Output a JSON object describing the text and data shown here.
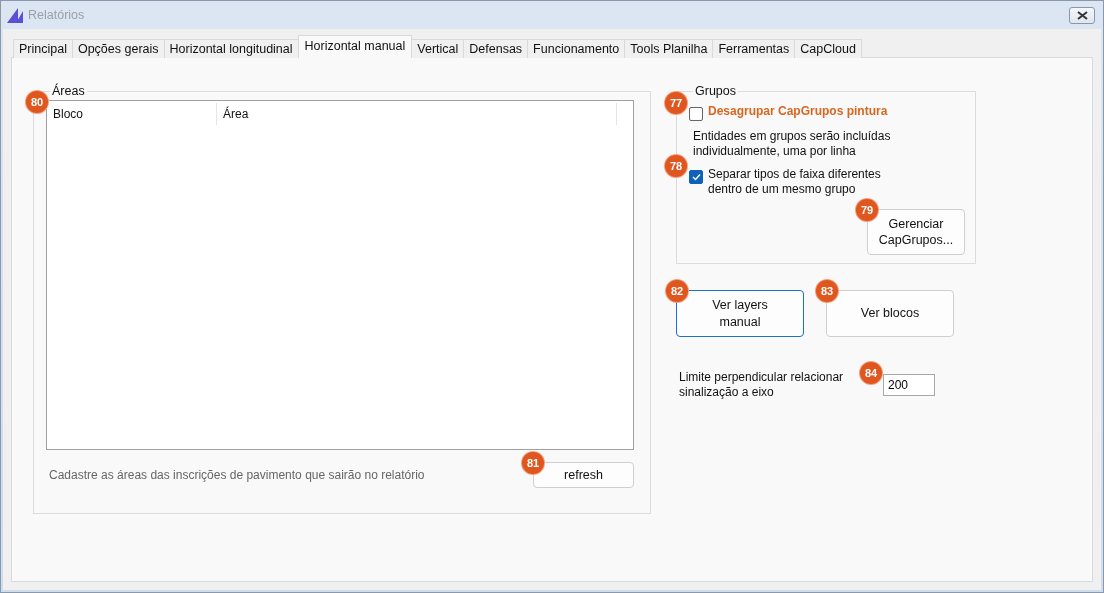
{
  "window": {
    "title": "Relatórios"
  },
  "tabs": [
    {
      "label": "Principal",
      "selected": false
    },
    {
      "label": "Opções gerais",
      "selected": false
    },
    {
      "label": "Horizontal longitudinal",
      "selected": false
    },
    {
      "label": "Horizontal manual",
      "selected": true
    },
    {
      "label": "Vertical",
      "selected": false
    },
    {
      "label": "Defensas",
      "selected": false
    },
    {
      "label": "Funcionamento",
      "selected": false
    },
    {
      "label": "Tools Planilha",
      "selected": false
    },
    {
      "label": "Ferramentas",
      "selected": false
    },
    {
      "label": "CapCloud",
      "selected": false
    }
  ],
  "areas": {
    "title": "Áreas",
    "badge": "80",
    "columns": [
      "Bloco",
      "Área"
    ],
    "hint": "Cadastre as áreas das inscrições de pavimento que sairão no relatório",
    "refresh_button": {
      "label": "refresh",
      "badge": "81"
    }
  },
  "grupos": {
    "title": "Grupos",
    "options": [
      {
        "label": "Desagrupar CapGrupos pintura",
        "checked": false,
        "highlighted": true,
        "badge": "77"
      },
      {
        "kind": "note",
        "label": "Entidades em grupos serão incluídas individualmente, uma por linha"
      },
      {
        "label": "Separar tipos de faixa diferentes dentro de um mesmo grupo",
        "checked": true,
        "highlighted": false,
        "badge": "78"
      }
    ],
    "manage_button": {
      "label": "Gerenciar CapGrupos...",
      "badge": "79"
    }
  },
  "buttons": [
    {
      "label": "Ver layers manual",
      "default": true,
      "badge": "82"
    },
    {
      "label": "Ver blocos",
      "default": false,
      "badge": "83"
    }
  ],
  "limit": {
    "label": "Limite perpendicular relacionar sinalização a eixo",
    "value": "200",
    "badge": "84"
  }
}
